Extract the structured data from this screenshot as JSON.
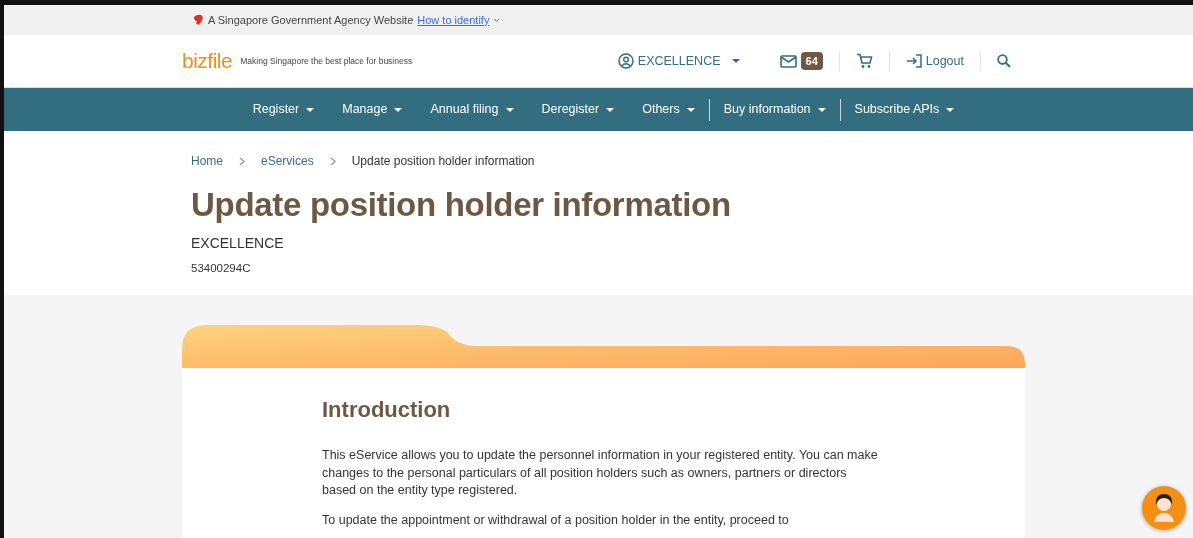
{
  "masthead": {
    "text": "A Singapore Government Agency Website",
    "link": "How to identify"
  },
  "header": {
    "logo": "bizfile",
    "tagline": "Making Singapore the best place for business",
    "user": "EXCELLENCE",
    "mail_count": "64",
    "logout": "Logout"
  },
  "nav": [
    {
      "label": "Register",
      "divider_before": false
    },
    {
      "label": "Manage",
      "divider_before": false
    },
    {
      "label": "Annual filing",
      "divider_before": false
    },
    {
      "label": "Deregister",
      "divider_before": false
    },
    {
      "label": "Others",
      "divider_before": false
    },
    {
      "label": "Buy information",
      "divider_before": true
    },
    {
      "label": "Subscribe APIs",
      "divider_before": true
    }
  ],
  "breadcrumb": [
    {
      "label": "Home",
      "current": false
    },
    {
      "label": "eServices",
      "current": false
    },
    {
      "label": "Update position holder information",
      "current": true
    }
  ],
  "title": "Update position holder information",
  "entity_name": "EXCELLENCE",
  "uen": "53400294C",
  "intro": {
    "heading": "Introduction",
    "paragraphs": [
      "This eService allows you to update the personnel information in your registered entity. You can make changes to the personal particulars of all position holders such as owners, partners or directors based on the entity type registered.",
      "To update the appointment or withdrawal of a position holder in the entity, proceed to"
    ]
  }
}
